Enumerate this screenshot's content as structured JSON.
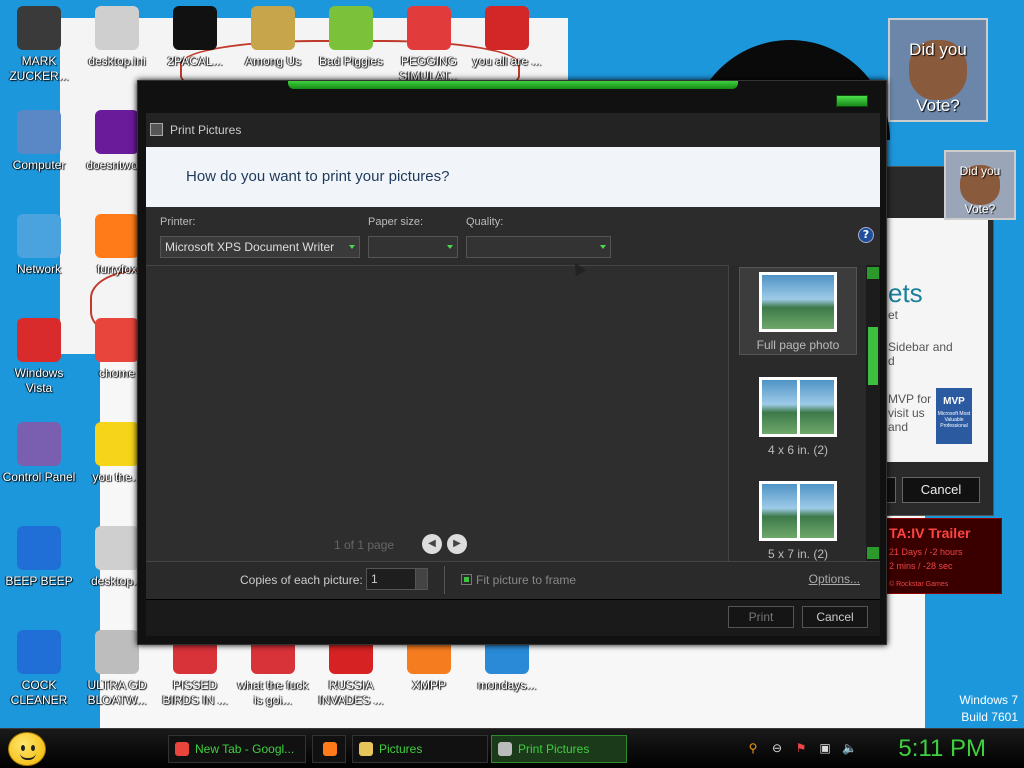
{
  "desktop": {
    "icons": [
      {
        "label": "MARK ZUCKER...",
        "icon": "figure-icon",
        "color": "#3a3a3a"
      },
      {
        "label": "desktop.ini",
        "icon": "settings-file-icon",
        "color": "#cfcfcf"
      },
      {
        "label": "2PACAL...",
        "icon": "terminal-icon",
        "color": "#111111"
      },
      {
        "label": "Among Us",
        "icon": "among-us-icon",
        "color": "#c7a54a"
      },
      {
        "label": "Bad Piggies",
        "icon": "bad-piggies-icon",
        "color": "#7cc13a"
      },
      {
        "label": "PEGGING SIMULAT...",
        "icon": "p-logo-icon",
        "color": "#e23b3b"
      },
      {
        "label": "you all are ...",
        "icon": "dev-cpp-icon",
        "color": "#d32727"
      },
      {
        "label": "Computer",
        "icon": "computer-icon",
        "color": "#5a87c5"
      },
      {
        "label": "doesntwo...",
        "icon": "yahoo-icon",
        "color": "#6a1b9a"
      },
      {
        "label": "Network",
        "icon": "network-icon",
        "color": "#4aa3df"
      },
      {
        "label": "furryfox",
        "icon": "firefox-icon",
        "color": "#ff7b1a"
      },
      {
        "label": "Windows Vista",
        "icon": "recycle-bin-icon",
        "color": "#d92b2b"
      },
      {
        "label": "chome",
        "icon": "chrome-icon",
        "color": "#e8453c"
      },
      {
        "label": "Control Panel",
        "icon": "control-panel-icon",
        "color": "#7a5fb0"
      },
      {
        "label": "you the...",
        "icon": "star-icon",
        "color": "#f5d41a"
      },
      {
        "label": "BEEP BEEP",
        "icon": "blue-file-icon",
        "color": "#1f6fd6"
      },
      {
        "label": "desktop...",
        "icon": "settings-file-icon",
        "color": "#cfcfcf"
      },
      {
        "label": "COCK CLEANER",
        "icon": "blue-file-icon",
        "color": "#1f6fd6"
      },
      {
        "label": "ULTRA GD BLOATW...",
        "icon": "disc-icon",
        "color": "#bdbdbd"
      },
      {
        "label": "PISSED BIRDS IN ...",
        "icon": "angry-birds-icon",
        "color": "#d9333a"
      },
      {
        "label": "what the fuck is goi...",
        "icon": "angry-birds-icon",
        "color": "#d9333a"
      },
      {
        "label": "RUSSIA INVADES ...",
        "icon": "radiation-icon",
        "color": "#d62222"
      },
      {
        "label": "XMPP",
        "icon": "xampp-icon",
        "color": "#f57c1f"
      },
      {
        "label": "mondays...",
        "icon": "calendar-icon",
        "color": "#2a8ad8"
      }
    ],
    "gadget_photo1_text": {
      "top": "Did you",
      "bottom": "Vote?"
    },
    "gadget_photo2_text": {
      "top": "Did you",
      "bottom": "Vote?"
    },
    "side_window": {
      "big_text": "ets",
      "line1": "et",
      "line2": "Sidebar and",
      "line3": "d",
      "line4": "MVP for",
      "line5": "visit us",
      "line6": "and",
      "badge": "MVP",
      "badge_sub": "Microsoft Most Valuable Professional",
      "cancel_label": "Cancel"
    },
    "gta_gadget": {
      "title": "TA:IV Trailer",
      "line1": "21 Days / -2 hours",
      "line2": "2 mins / -28 sec",
      "line3": "© Rockstar Games"
    },
    "build": {
      "os": "Windows 7",
      "build": "Build 7601"
    }
  },
  "dialog": {
    "title": "Print Pictures",
    "heading": "How do you want to print your pictures?",
    "printer_label": "Printer:",
    "printer_value": "Microsoft XPS Document Writer",
    "paper_label": "Paper size:",
    "paper_value": "",
    "quality_label": "Quality:",
    "quality_value": "",
    "help": "?",
    "page_label": "1 of 1 page",
    "layouts": [
      {
        "label": "Full page photo",
        "selected": true
      },
      {
        "label": "4 x 6 in. (2)",
        "selected": false
      },
      {
        "label": "5 x 7 in. (2)",
        "selected": false
      }
    ],
    "copies_label": "Copies of each picture:",
    "copies_value": "1",
    "fit_label": "Fit picture to frame",
    "options_label": "Options...",
    "print_label": "Print",
    "cancel_label": "Cancel"
  },
  "taskbar": {
    "tasks": [
      {
        "label": "New Tab - Googl...",
        "icon": "chrome-icon"
      },
      {
        "label": "",
        "icon": "firefox-icon"
      },
      {
        "label": "Pictures",
        "icon": "folder-icon"
      },
      {
        "label": "Print Pictures",
        "icon": "printer-icon"
      }
    ],
    "clock": "5:11 PM"
  }
}
